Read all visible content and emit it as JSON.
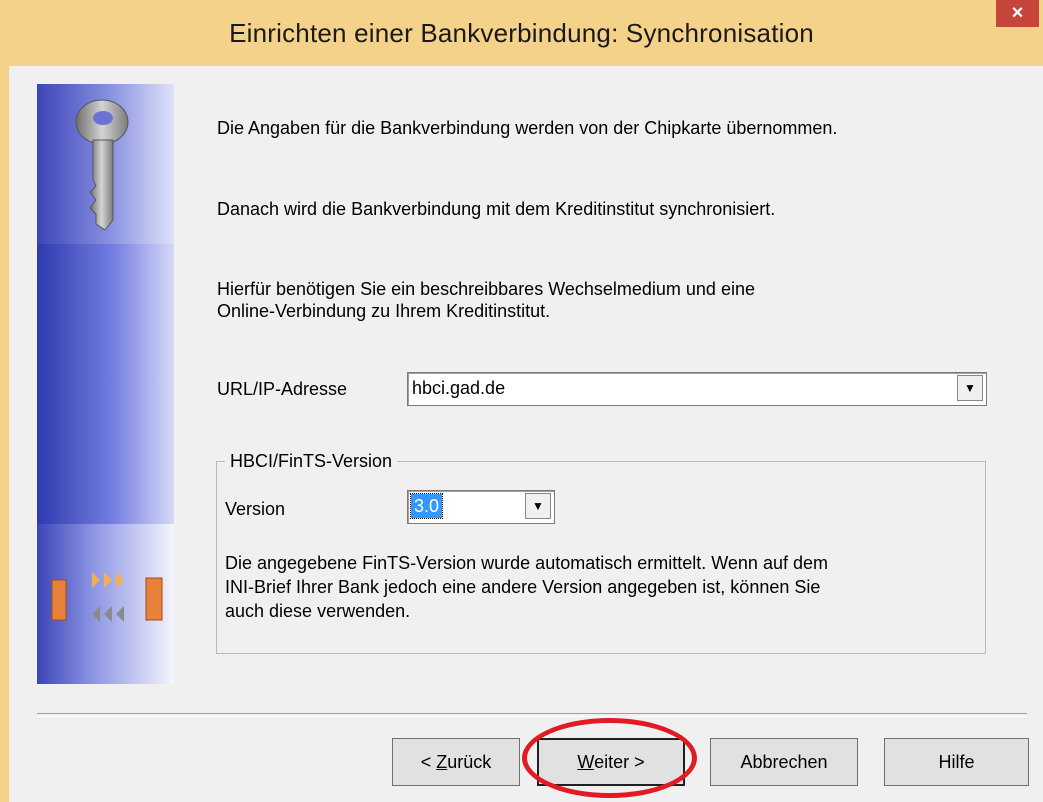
{
  "window": {
    "title": "Einrichten einer Bankverbindung: Synchronisation",
    "close_glyph": "×"
  },
  "intro": {
    "line1": "Die Angaben für die Bankverbindung werden von der Chipkarte übernommen.",
    "line2": "Danach wird die Bankverbindung mit dem Kreditinstitut synchronisiert.",
    "line3a": "Hierfür benötigen Sie ein beschreibbares Wechselmedium und eine",
    "line3b": "Online-Verbindung zu Ihrem Kreditinstitut."
  },
  "url_field": {
    "label": "URL/IP-Adresse",
    "value": "hbci.gad.de"
  },
  "version_group": {
    "title": "HBCI/FinTS-Version",
    "label": "Version",
    "value": "3.0",
    "note1": "Die angegebene FinTS-Version wurde automatisch ermittelt. Wenn auf dem",
    "note2": "INI-Brief Ihrer Bank jedoch eine andere Version angegeben ist, können Sie",
    "note3": "auch diese verwenden."
  },
  "buttons": {
    "back_prefix": "< ",
    "back_accel": "Z",
    "back_rest": "urück",
    "next_accel": "W",
    "next_rest": "eiter >",
    "cancel": "Abbrechen",
    "help": "Hilfe"
  },
  "colors": {
    "titlebar": "#f5d289",
    "close": "#c7453a",
    "banner": "#3c45b6",
    "annotation": "#e01b24"
  },
  "icons": {
    "banner_top": "key-icon",
    "banner_bottom": "sync-arrows-icon",
    "dropdown": "chevron-down-icon"
  }
}
